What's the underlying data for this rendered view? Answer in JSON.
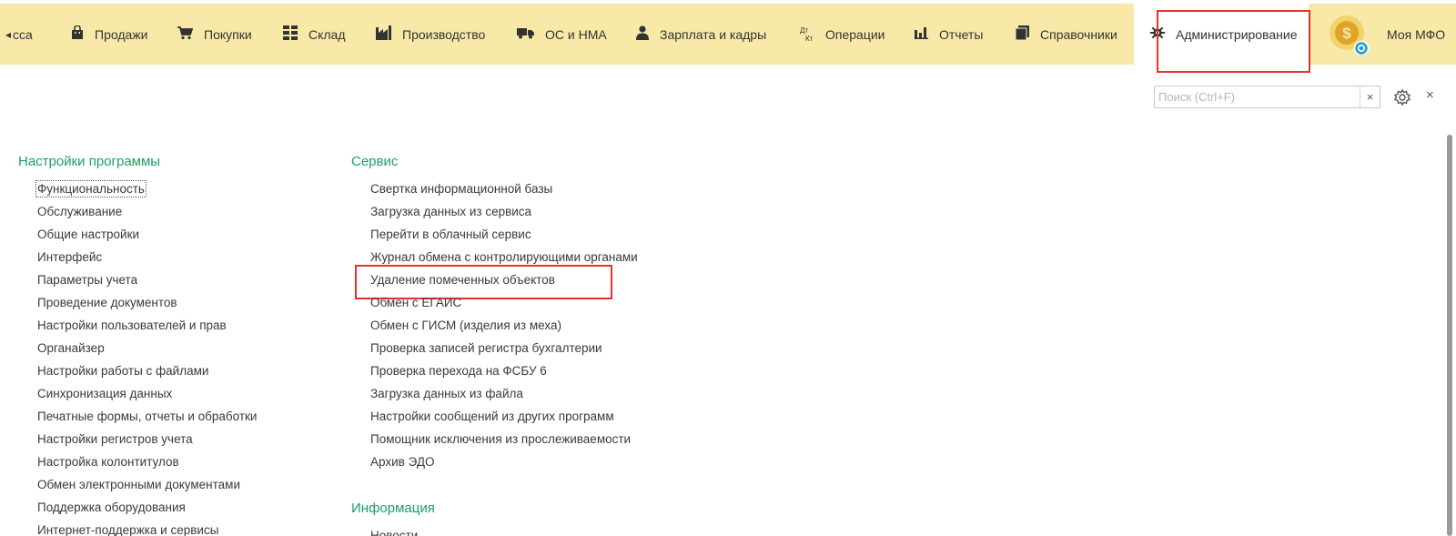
{
  "nav": {
    "back_arrow": "◂",
    "items": [
      {
        "label": "ссa",
        "icon": "cash-register-icon"
      },
      {
        "label": "Продажи",
        "icon": "shopping-bag-icon"
      },
      {
        "label": "Покупки",
        "icon": "shopping-cart-icon"
      },
      {
        "label": "Склад",
        "icon": "warehouse-grid-icon"
      },
      {
        "label": "Производство",
        "icon": "factory-icon"
      },
      {
        "label": "ОС и НМА",
        "icon": "truck-icon"
      },
      {
        "label": "Зарплата и кадры",
        "icon": "person-icon"
      },
      {
        "label": "Операции",
        "icon": "debit-credit-icon"
      },
      {
        "label": "Отчеты",
        "icon": "bar-chart-icon"
      },
      {
        "label": "Справочники",
        "icon": "books-icon"
      },
      {
        "label": "Администрирование",
        "icon": "gear-icon"
      },
      {
        "label": "Моя МФО",
        "icon": "coin-settings-icon"
      }
    ],
    "active": "Администрирование",
    "dt_label": "Дт",
    "kt_label": "Кт"
  },
  "search": {
    "placeholder": "Поиск (Ctrl+F)",
    "value": "",
    "clear": "×"
  },
  "toolbar": {
    "settings_icon": "gear-icon",
    "close": "×"
  },
  "sections": {
    "settings": {
      "title": "Настройки программы",
      "items": [
        "Функциональность",
        "Обслуживание",
        "Общие настройки",
        "Интерфейс",
        "Параметры учета",
        "Проведение документов",
        "Настройки пользователей и прав",
        "Органайзер",
        "Настройки работы с файлами",
        "Синхронизация данных",
        "Печатные формы, отчеты и обработки",
        "Настройки регистров учета",
        "Настройка колонтитулов",
        "Обмен электронными документами",
        "Поддержка оборудования",
        "Интернет-поддержка и сервисы"
      ]
    },
    "service": {
      "title": "Сервис",
      "items": [
        "Свертка информационной базы",
        "Загрузка данных из сервиса",
        "Перейти в облачный сервис",
        "Журнал обмена с контролирующими органами",
        "Удаление помеченных объектов",
        "Обмен с ЕГАИС",
        "Обмен с ГИСМ (изделия из меха)",
        "Проверка записей регистра бухгалтерии",
        "Проверка перехода на ФСБУ 6",
        "Загрузка данных из файла",
        "Настройки сообщений из других программ",
        "Помощник исключения из прослеживаемости",
        "Архив ЭДО"
      ]
    },
    "info": {
      "title": "Информация",
      "items": [
        "Новости"
      ]
    }
  },
  "colors": {
    "topbar": "#f8e9a8",
    "section_title": "#1aa163",
    "highlight": "#e5322d"
  }
}
